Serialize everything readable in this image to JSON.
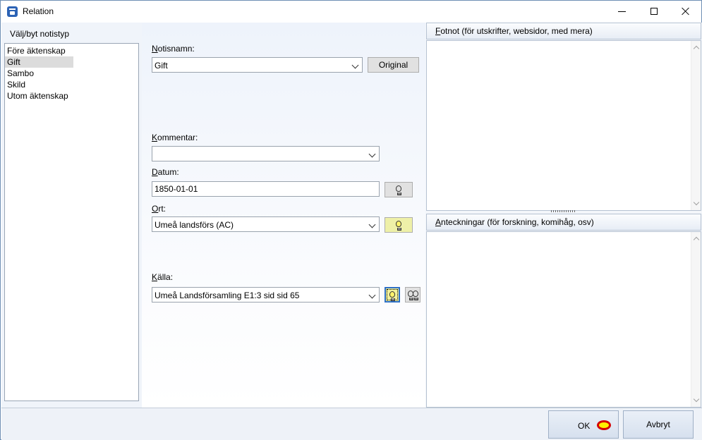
{
  "window": {
    "title": "Relation"
  },
  "left": {
    "header": "Välj/byt notistyp",
    "items": [
      {
        "label": "Före äktenskap",
        "selected": false
      },
      {
        "label": "Gift",
        "selected": true
      },
      {
        "label": "Sambo",
        "selected": false
      },
      {
        "label": "Skild",
        "selected": false
      },
      {
        "label": "Utom äktenskap",
        "selected": false
      }
    ]
  },
  "form": {
    "notisnamn_label_u": "N",
    "notisnamn_label_rest": "otisnamn:",
    "notisnamn_value": "Gift",
    "original_button": "Original",
    "kommentar_label_u": "K",
    "kommentar_label_rest": "ommentar:",
    "kommentar_value": "",
    "datum_label_u": "D",
    "datum_label_rest": "atum:",
    "datum_value": "1850-01-01",
    "ort_label_u": "O",
    "ort_label_rest": "rt:",
    "ort_value": "Umeå landsförs (AC)",
    "kalla_label_u": "K",
    "kalla_label_rest": "älla:",
    "kalla_value": "Umeå Landsförsamling E1:3 sid  sid 65"
  },
  "right": {
    "fotnot_header_u": "F",
    "fotnot_header_rest": "otnot (för utskrifter, websidor, med mera)",
    "anteckningar_header_u": "A",
    "anteckningar_header_rest": "nteckningar (för forskning, komihåg, osv)"
  },
  "buttons": {
    "ok": "OK",
    "cancel": "Avbryt"
  },
  "colors": {
    "selection": "#dcdcdc",
    "click_marker_fill": "#ffef00",
    "click_marker_ring": "#d40000",
    "bulb_lit": "#fff36b"
  }
}
